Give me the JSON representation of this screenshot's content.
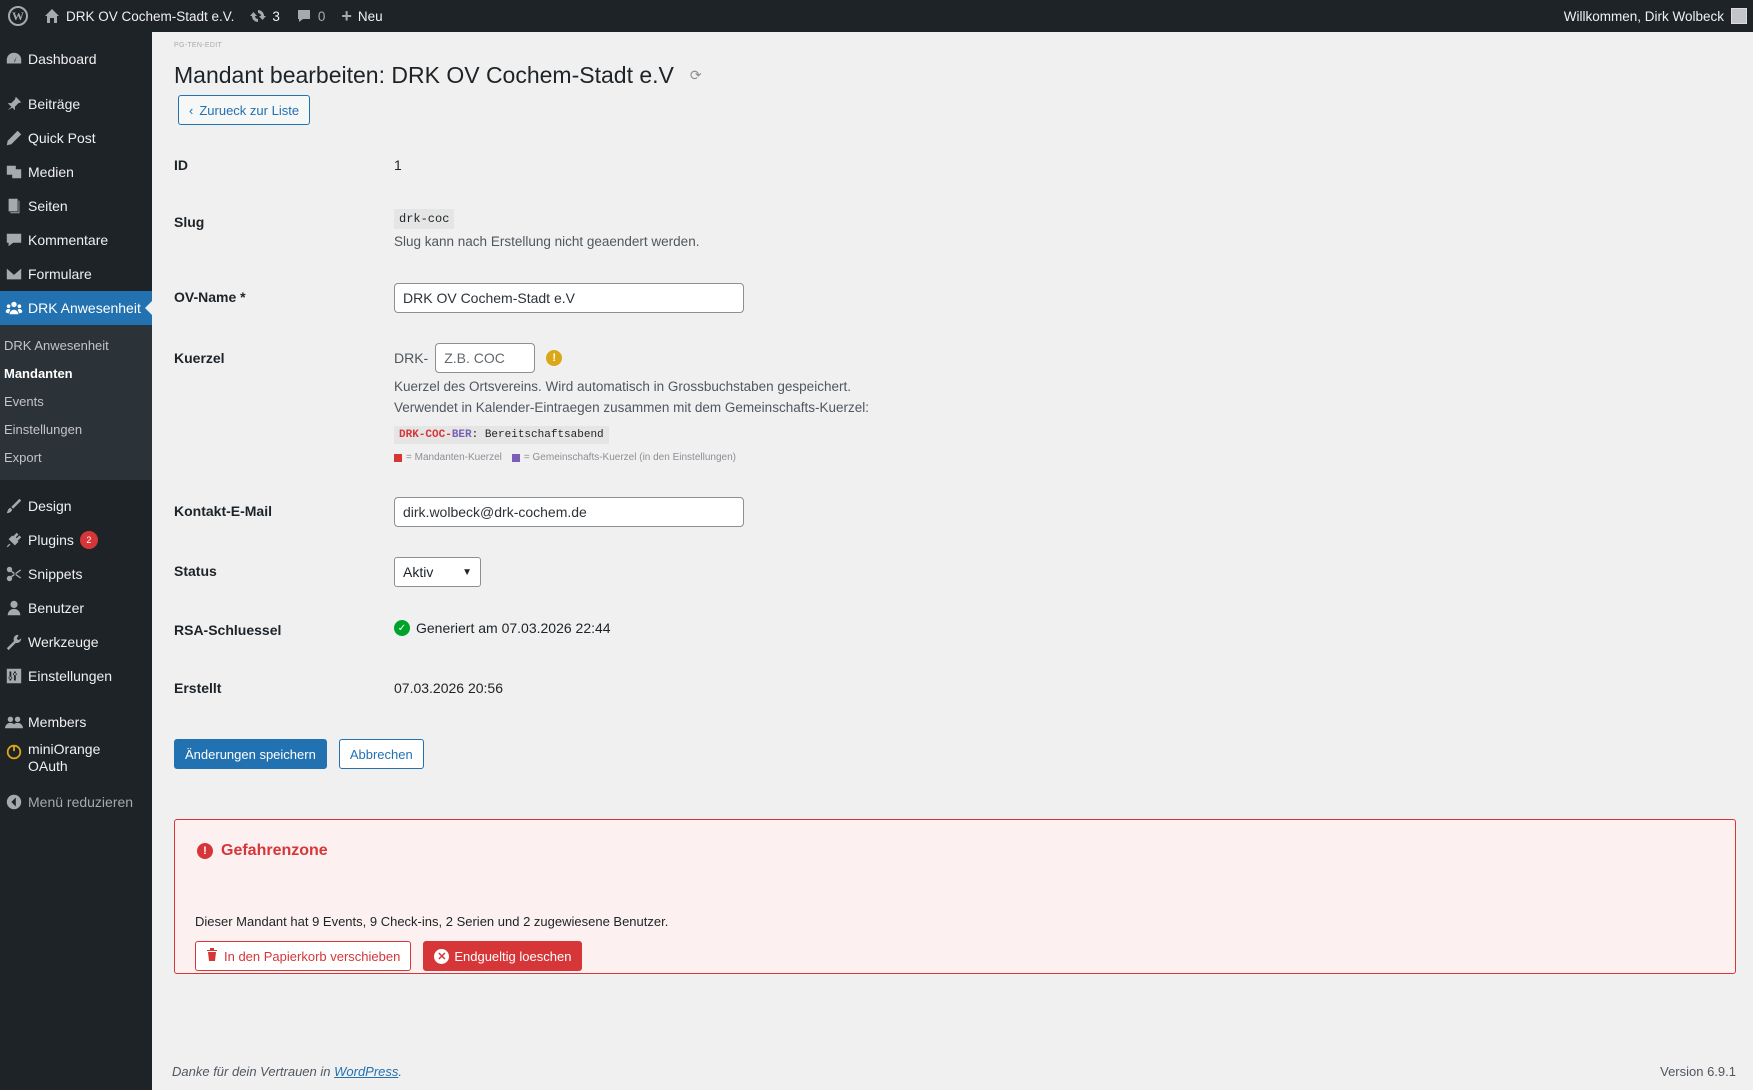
{
  "adminbar": {
    "site_name": "DRK OV Cochem-Stadt e.V.",
    "updates_count": "3",
    "comments_count": "0",
    "new_label": "Neu",
    "greeting": "Willkommen, Dirk Wolbeck"
  },
  "sidebar": {
    "items": [
      {
        "label": "Dashboard",
        "icon": "dashboard-icon"
      },
      {
        "label": "Beiträge",
        "icon": "pin-icon"
      },
      {
        "label": "Quick Post",
        "icon": "pencil-icon"
      },
      {
        "label": "Medien",
        "icon": "media-icon"
      },
      {
        "label": "Seiten",
        "icon": "pages-icon"
      },
      {
        "label": "Kommentare",
        "icon": "comment-icon"
      },
      {
        "label": "Formulare",
        "icon": "mail-icon"
      },
      {
        "label": "DRK Anwesenheit",
        "icon": "groups-icon"
      },
      {
        "label": "Design",
        "icon": "brush-icon"
      },
      {
        "label": "Plugins",
        "icon": "plugin-icon",
        "badge": "2"
      },
      {
        "label": "Snippets",
        "icon": "scissors-icon"
      },
      {
        "label": "Benutzer",
        "icon": "user-icon"
      },
      {
        "label": "Werkzeuge",
        "icon": "wrench-icon"
      },
      {
        "label": "Einstellungen",
        "icon": "settings-icon"
      },
      {
        "label": "Members",
        "icon": "members-icon"
      },
      {
        "label": "miniOrange OAuth",
        "icon": "oauth-icon"
      }
    ],
    "submenu": [
      "DRK Anwesenheit",
      "Mandanten",
      "Events",
      "Einstellungen",
      "Export"
    ],
    "collapse_label": "Menü reduzieren"
  },
  "page": {
    "tiny_label": "PG-TEN-EDIT",
    "title": "Mandant bearbeiten: DRK OV Cochem-Stadt e.V",
    "back_label": "Zurueck zur Liste"
  },
  "form": {
    "id_label": "ID",
    "id_value": "1",
    "slug_label": "Slug",
    "slug_value": "drk-coc",
    "slug_desc": "Slug kann nach Erstellung nicht geaendert werden.",
    "ovname_label": "OV-Name *",
    "ovname_value": "DRK OV Cochem-Stadt e.V",
    "kuerzel_label": "Kuerzel",
    "kuerzel_prefix": "DRK-",
    "kuerzel_placeholder": "Z.B. COC",
    "kuerzel_desc1": "Kuerzel des Ortsvereins. Wird automatisch in Grossbuchstaben gespeichert.",
    "kuerzel_desc2": "Verwendet in Kalender-Eintraegen zusammen mit dem Gemeinschafts-Kuerzel:",
    "example_red": "DRK-COC-",
    "example_purple": "BER",
    "example_rest": ": Bereitschaftsabend",
    "legend_red": "= Mandanten-Kuerzel",
    "legend_purple": "= Gemeinschafts-Kuerzel (in den Einstellungen)",
    "email_label": "Kontakt-E-Mail",
    "email_value": "dirk.wolbeck@drk-cochem.de",
    "status_label": "Status",
    "status_value": "Aktiv",
    "rsa_label": "RSA-Schluessel",
    "rsa_value": "Generiert am 07.03.2026 22:44",
    "created_label": "Erstellt",
    "created_value": "07.03.2026 20:56",
    "save_label": "Änderungen speichern",
    "cancel_label": "Abbrechen"
  },
  "danger": {
    "title": "Gefahrenzone",
    "text": "Dieser Mandant hat 9 Events, 9 Check-ins, 2 Serien und 2 zugewiesene Benutzer.",
    "trash_label": "In den Papierkorb verschieben",
    "delete_label": "Endgueltig loeschen"
  },
  "footer": {
    "thanks_prefix": "Danke für dein Vertrauen in ",
    "thanks_link": "WordPress",
    "thanks_suffix": ".",
    "version": "Version 6.9.1"
  },
  "colors": {
    "accent": "#2271b1",
    "danger": "#d63638",
    "sidebar": "#1d2327",
    "warning": "#dba617",
    "success": "#00a32a",
    "gemeinschaft": "#7a5fb8"
  }
}
